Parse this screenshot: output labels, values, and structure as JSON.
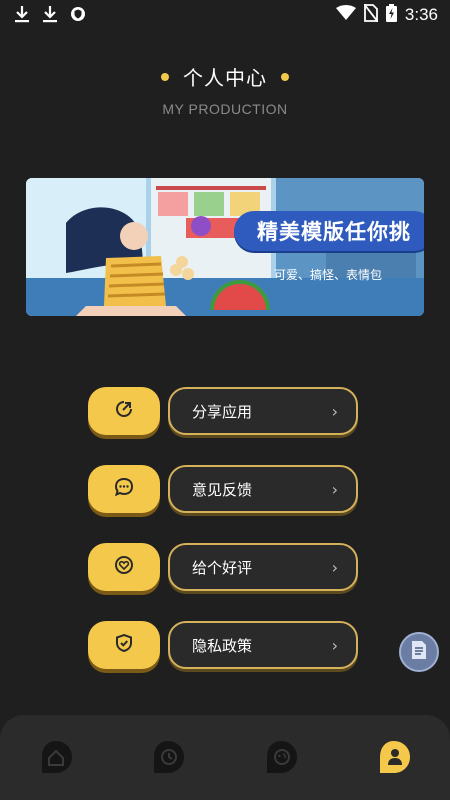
{
  "status_bar": {
    "time": "3:36"
  },
  "header": {
    "title": "个人中心",
    "subtitle": "MY PRODUCTION"
  },
  "banner": {
    "headline": "精美模版任你挑",
    "subtext": "可爱、搞怪、表情包"
  },
  "menu": {
    "items": [
      {
        "label": "分享应用",
        "icon": "share-icon"
      },
      {
        "label": "意见反馈",
        "icon": "feedback-icon"
      },
      {
        "label": "给个好评",
        "icon": "heart-icon"
      },
      {
        "label": "隐私政策",
        "icon": "shield-icon"
      }
    ]
  },
  "bottom_nav": {
    "items": [
      {
        "icon": "home-icon",
        "active": false
      },
      {
        "icon": "clock-icon",
        "active": false
      },
      {
        "icon": "face-icon",
        "active": false
      },
      {
        "icon": "profile-icon",
        "active": true
      }
    ]
  },
  "colors": {
    "accent": "#f4c84a",
    "background": "#1f1f1f",
    "banner_pill": "#2e5bbd"
  }
}
